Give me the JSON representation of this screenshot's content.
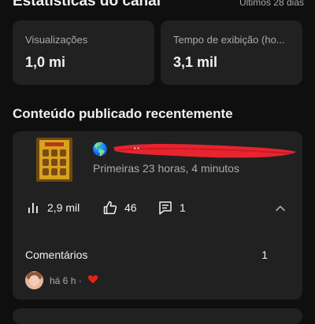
{
  "header": {
    "title": "Estatísticas do canal",
    "period": "Últimos 28 dias"
  },
  "stats": [
    {
      "label": "Visualizações",
      "value": "1,0 mi"
    },
    {
      "label": "Tempo de exibição (ho...",
      "value": "3,1 mil"
    }
  ],
  "recent": {
    "section_title": "Conteúdo publicado recentemente",
    "video": {
      "meta": "Primeiras 23 horas, 4 minutos",
      "globe_icon": "globe-icon",
      "title_redacted_color": "#e8242f",
      "views": "2,9 mil",
      "likes": "46",
      "comments": "1"
    },
    "comments_section": {
      "label": "Comentários",
      "count": "1",
      "latest_time": "há 6 h ·",
      "heart_color": "#e62117"
    }
  },
  "colors": {
    "background": "#0f0f0f",
    "card": "#212121",
    "text_primary": "#f1f1f1",
    "text_secondary": "#aaaaaa"
  }
}
